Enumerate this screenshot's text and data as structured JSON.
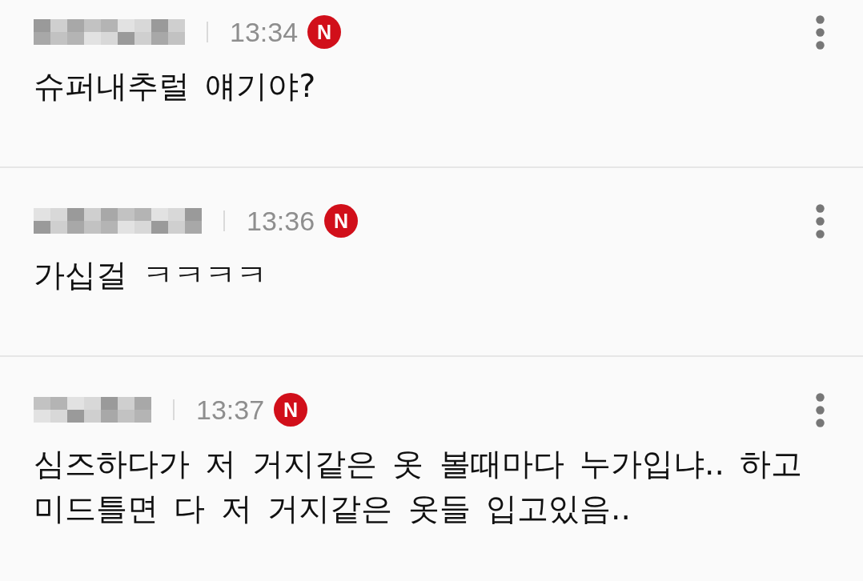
{
  "comments": [
    {
      "time": "13:34",
      "badge": "N",
      "text": "슈퍼내추럴 얘기야?"
    },
    {
      "time": "13:36",
      "badge": "N",
      "text": "가십걸 ㅋㅋㅋㅋ"
    },
    {
      "time": "13:37",
      "badge": "N",
      "text": "심즈하다가 저 거지같은 옷 볼때마다 누가입냐.. 하고 미드틀면 다 저 거지같은 옷들 입고있음.."
    }
  ]
}
